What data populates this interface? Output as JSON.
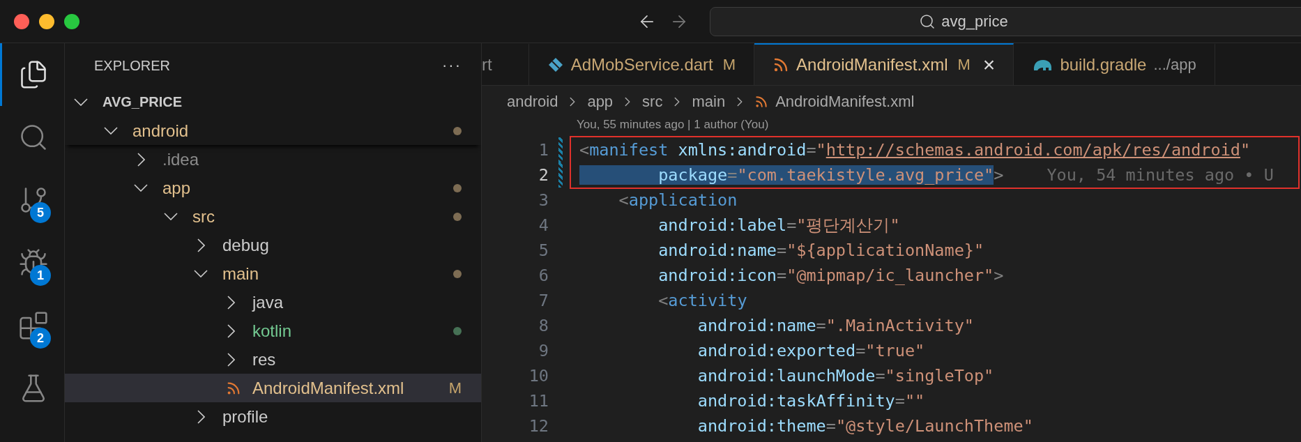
{
  "title_bar": {
    "search": {
      "value": "avg_price"
    }
  },
  "activity_bar": [
    {
      "kind": "explorer",
      "selected": true
    },
    {
      "kind": "search",
      "selected": false
    },
    {
      "kind": "source-control",
      "selected": false,
      "badge": "5"
    },
    {
      "kind": "run-debug",
      "selected": false,
      "badge": "1"
    },
    {
      "kind": "extensions",
      "selected": false,
      "badge": "2"
    },
    {
      "kind": "testing",
      "selected": false
    }
  ],
  "sidebar": {
    "title": "EXPLORER",
    "more": "···",
    "tree": [
      {
        "label": "AVG_PRICE",
        "kind": "root",
        "expanded": true,
        "selected": false,
        "color": "#cccccc",
        "dot": false,
        "children": [
          {
            "label": "android",
            "kind": "folder",
            "expanded": true,
            "selected": false,
            "color": "#e2c08d",
            "dot": true,
            "children": [
              {
                "label": ".idea",
                "kind": "folder",
                "expanded": false,
                "selected": false,
                "color": "#8c8c8c",
                "dot": false
              },
              {
                "label": "app",
                "kind": "folder",
                "expanded": true,
                "selected": false,
                "color": "#e2c08d",
                "dot": true,
                "children": [
                  {
                    "label": "src",
                    "kind": "folder",
                    "expanded": true,
                    "selected": false,
                    "color": "#e2c08d",
                    "dot": true,
                    "children": [
                      {
                        "label": "debug",
                        "kind": "folder",
                        "expanded": false,
                        "selected": false,
                        "color": "#cccccc",
                        "dot": false
                      },
                      {
                        "label": "main",
                        "kind": "folder",
                        "expanded": true,
                        "selected": false,
                        "color": "#e2c08d",
                        "dot": true,
                        "children": [
                          {
                            "label": "java",
                            "kind": "folder",
                            "expanded": false,
                            "selected": false,
                            "color": "#cccccc",
                            "dot": false
                          },
                          {
                            "label": "kotlin",
                            "kind": "folder",
                            "expanded": false,
                            "selected": false,
                            "color": "#73c991",
                            "dot": true
                          },
                          {
                            "label": "res",
                            "kind": "folder",
                            "expanded": false,
                            "selected": false,
                            "color": "#cccccc",
                            "dot": false
                          },
                          {
                            "label": "AndroidManifest.xml",
                            "kind": "xml",
                            "expanded": false,
                            "selected": true,
                            "color": "#e2c08d",
                            "dot": false,
                            "badge": "M"
                          }
                        ]
                      },
                      {
                        "label": "profile",
                        "kind": "folder",
                        "expanded": false,
                        "selected": false,
                        "color": "#cccccc",
                        "dot": false
                      }
                    ]
                  }
                ]
              }
            ]
          }
        ]
      }
    ]
  },
  "tabs": [
    {
      "label": "rt",
      "kind": "plain",
      "selected": false
    },
    {
      "label": "AdMobService.dart",
      "kind": "dart",
      "selected": false,
      "badge": "M"
    },
    {
      "label": "AndroidManifest.xml",
      "kind": "xml",
      "selected": true,
      "badge": "M",
      "close": "×"
    },
    {
      "label": "build.gradle",
      "kind": "gradle",
      "selected": false,
      "detail": ".../app"
    }
  ],
  "breadcrumb": [
    {
      "label": "android",
      "kind": "folder"
    },
    {
      "label": "app",
      "kind": "folder"
    },
    {
      "label": "src",
      "kind": "folder"
    },
    {
      "label": "main",
      "kind": "folder"
    },
    {
      "label": "AndroidManifest.xml",
      "kind": "xml"
    }
  ],
  "blame_header": "You, 55 minutes ago | 1 author (You)",
  "code": {
    "lines": [
      {
        "number": "1",
        "current": false,
        "framed": true,
        "modified": true,
        "segments": [
          {
            "kind": "punct",
            "text": "<"
          },
          {
            "kind": "tag",
            "text": "manifest"
          },
          {
            "kind": "attr",
            "text": " xmlns:android"
          },
          {
            "kind": "punct",
            "text": "="
          },
          {
            "kind": "string",
            "text": "\""
          },
          {
            "kind": "link",
            "text": "http://schemas.android.com/apk/res/android"
          },
          {
            "kind": "string",
            "text": "\""
          }
        ]
      },
      {
        "number": "2",
        "current": true,
        "framed": true,
        "modified": true,
        "blame": "You, 54 minutes ago • U",
        "segments": [
          {
            "kind": "attr",
            "text": "        package",
            "selected": true
          },
          {
            "kind": "punct",
            "text": "=",
            "selected": true
          },
          {
            "kind": "string",
            "text": "\"com.taekistyle.avg_price\"",
            "selected": true
          },
          {
            "kind": "punct",
            "text": ">"
          }
        ]
      },
      {
        "number": "3",
        "current": false,
        "framed": false,
        "modified": false,
        "segments": [
          {
            "kind": "punct",
            "text": "    <"
          },
          {
            "kind": "tag",
            "text": "application"
          }
        ]
      },
      {
        "number": "4",
        "current": false,
        "framed": false,
        "modified": false,
        "segments": [
          {
            "kind": "attr",
            "text": "        android:label"
          },
          {
            "kind": "punct",
            "text": "="
          },
          {
            "kind": "string",
            "text": "\"평단계산기\""
          }
        ]
      },
      {
        "number": "5",
        "current": false,
        "framed": false,
        "modified": false,
        "segments": [
          {
            "kind": "attr",
            "text": "        android:name"
          },
          {
            "kind": "punct",
            "text": "="
          },
          {
            "kind": "string",
            "text": "\"${applicationName}\""
          }
        ]
      },
      {
        "number": "6",
        "current": false,
        "framed": false,
        "modified": false,
        "segments": [
          {
            "kind": "attr",
            "text": "        android:icon"
          },
          {
            "kind": "punct",
            "text": "="
          },
          {
            "kind": "string",
            "text": "\"@mipmap/ic_launcher\""
          },
          {
            "kind": "punct",
            "text": ">"
          }
        ]
      },
      {
        "number": "7",
        "current": false,
        "framed": false,
        "modified": false,
        "segments": [
          {
            "kind": "punct",
            "text": "        <"
          },
          {
            "kind": "tag",
            "text": "activity"
          }
        ]
      },
      {
        "number": "8",
        "current": false,
        "framed": false,
        "modified": false,
        "segments": [
          {
            "kind": "attr",
            "text": "            android:name"
          },
          {
            "kind": "punct",
            "text": "="
          },
          {
            "kind": "string",
            "text": "\".MainActivity\""
          }
        ]
      },
      {
        "number": "9",
        "current": false,
        "framed": false,
        "modified": false,
        "segments": [
          {
            "kind": "attr",
            "text": "            android:exported"
          },
          {
            "kind": "punct",
            "text": "="
          },
          {
            "kind": "string",
            "text": "\"true\""
          }
        ]
      },
      {
        "number": "10",
        "current": false,
        "framed": false,
        "modified": false,
        "segments": [
          {
            "kind": "attr",
            "text": "            android:launchMode"
          },
          {
            "kind": "punct",
            "text": "="
          },
          {
            "kind": "string",
            "text": "\"singleTop\""
          }
        ]
      },
      {
        "number": "11",
        "current": false,
        "framed": false,
        "modified": false,
        "segments": [
          {
            "kind": "attr",
            "text": "            android:taskAffinity"
          },
          {
            "kind": "punct",
            "text": "="
          },
          {
            "kind": "string",
            "text": "\"\""
          }
        ]
      },
      {
        "number": "12",
        "current": false,
        "framed": false,
        "modified": false,
        "segments": [
          {
            "kind": "attr",
            "text": "            android:theme"
          },
          {
            "kind": "punct",
            "text": "="
          },
          {
            "kind": "string",
            "text": "\"@style/LaunchTheme\""
          }
        ]
      }
    ]
  }
}
